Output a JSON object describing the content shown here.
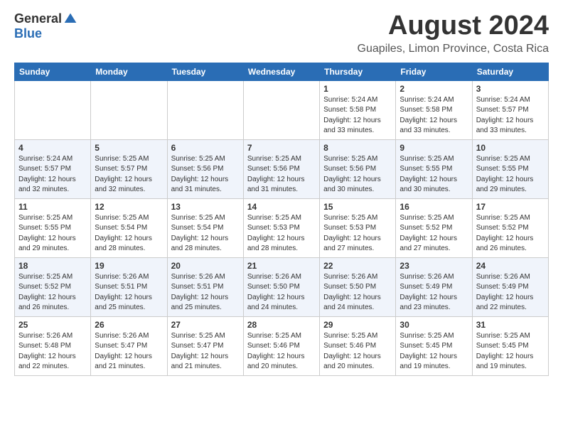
{
  "header": {
    "logo_general": "General",
    "logo_blue": "Blue",
    "month_title": "August 2024",
    "subtitle": "Guapiles, Limon Province, Costa Rica"
  },
  "calendar": {
    "days_of_week": [
      "Sunday",
      "Monday",
      "Tuesday",
      "Wednesday",
      "Thursday",
      "Friday",
      "Saturday"
    ],
    "weeks": [
      [
        {
          "day": "",
          "info": ""
        },
        {
          "day": "",
          "info": ""
        },
        {
          "day": "",
          "info": ""
        },
        {
          "day": "",
          "info": ""
        },
        {
          "day": "1",
          "info": "Sunrise: 5:24 AM\nSunset: 5:58 PM\nDaylight: 12 hours\nand 33 minutes."
        },
        {
          "day": "2",
          "info": "Sunrise: 5:24 AM\nSunset: 5:58 PM\nDaylight: 12 hours\nand 33 minutes."
        },
        {
          "day": "3",
          "info": "Sunrise: 5:24 AM\nSunset: 5:57 PM\nDaylight: 12 hours\nand 33 minutes."
        }
      ],
      [
        {
          "day": "4",
          "info": "Sunrise: 5:24 AM\nSunset: 5:57 PM\nDaylight: 12 hours\nand 32 minutes."
        },
        {
          "day": "5",
          "info": "Sunrise: 5:25 AM\nSunset: 5:57 PM\nDaylight: 12 hours\nand 32 minutes."
        },
        {
          "day": "6",
          "info": "Sunrise: 5:25 AM\nSunset: 5:56 PM\nDaylight: 12 hours\nand 31 minutes."
        },
        {
          "day": "7",
          "info": "Sunrise: 5:25 AM\nSunset: 5:56 PM\nDaylight: 12 hours\nand 31 minutes."
        },
        {
          "day": "8",
          "info": "Sunrise: 5:25 AM\nSunset: 5:56 PM\nDaylight: 12 hours\nand 30 minutes."
        },
        {
          "day": "9",
          "info": "Sunrise: 5:25 AM\nSunset: 5:55 PM\nDaylight: 12 hours\nand 30 minutes."
        },
        {
          "day": "10",
          "info": "Sunrise: 5:25 AM\nSunset: 5:55 PM\nDaylight: 12 hours\nand 29 minutes."
        }
      ],
      [
        {
          "day": "11",
          "info": "Sunrise: 5:25 AM\nSunset: 5:55 PM\nDaylight: 12 hours\nand 29 minutes."
        },
        {
          "day": "12",
          "info": "Sunrise: 5:25 AM\nSunset: 5:54 PM\nDaylight: 12 hours\nand 28 minutes."
        },
        {
          "day": "13",
          "info": "Sunrise: 5:25 AM\nSunset: 5:54 PM\nDaylight: 12 hours\nand 28 minutes."
        },
        {
          "day": "14",
          "info": "Sunrise: 5:25 AM\nSunset: 5:53 PM\nDaylight: 12 hours\nand 28 minutes."
        },
        {
          "day": "15",
          "info": "Sunrise: 5:25 AM\nSunset: 5:53 PM\nDaylight: 12 hours\nand 27 minutes."
        },
        {
          "day": "16",
          "info": "Sunrise: 5:25 AM\nSunset: 5:52 PM\nDaylight: 12 hours\nand 27 minutes."
        },
        {
          "day": "17",
          "info": "Sunrise: 5:25 AM\nSunset: 5:52 PM\nDaylight: 12 hours\nand 26 minutes."
        }
      ],
      [
        {
          "day": "18",
          "info": "Sunrise: 5:25 AM\nSunset: 5:52 PM\nDaylight: 12 hours\nand 26 minutes."
        },
        {
          "day": "19",
          "info": "Sunrise: 5:26 AM\nSunset: 5:51 PM\nDaylight: 12 hours\nand 25 minutes."
        },
        {
          "day": "20",
          "info": "Sunrise: 5:26 AM\nSunset: 5:51 PM\nDaylight: 12 hours\nand 25 minutes."
        },
        {
          "day": "21",
          "info": "Sunrise: 5:26 AM\nSunset: 5:50 PM\nDaylight: 12 hours\nand 24 minutes."
        },
        {
          "day": "22",
          "info": "Sunrise: 5:26 AM\nSunset: 5:50 PM\nDaylight: 12 hours\nand 24 minutes."
        },
        {
          "day": "23",
          "info": "Sunrise: 5:26 AM\nSunset: 5:49 PM\nDaylight: 12 hours\nand 23 minutes."
        },
        {
          "day": "24",
          "info": "Sunrise: 5:26 AM\nSunset: 5:49 PM\nDaylight: 12 hours\nand 22 minutes."
        }
      ],
      [
        {
          "day": "25",
          "info": "Sunrise: 5:26 AM\nSunset: 5:48 PM\nDaylight: 12 hours\nand 22 minutes."
        },
        {
          "day": "26",
          "info": "Sunrise: 5:26 AM\nSunset: 5:47 PM\nDaylight: 12 hours\nand 21 minutes."
        },
        {
          "day": "27",
          "info": "Sunrise: 5:25 AM\nSunset: 5:47 PM\nDaylight: 12 hours\nand 21 minutes."
        },
        {
          "day": "28",
          "info": "Sunrise: 5:25 AM\nSunset: 5:46 PM\nDaylight: 12 hours\nand 20 minutes."
        },
        {
          "day": "29",
          "info": "Sunrise: 5:25 AM\nSunset: 5:46 PM\nDaylight: 12 hours\nand 20 minutes."
        },
        {
          "day": "30",
          "info": "Sunrise: 5:25 AM\nSunset: 5:45 PM\nDaylight: 12 hours\nand 19 minutes."
        },
        {
          "day": "31",
          "info": "Sunrise: 5:25 AM\nSunset: 5:45 PM\nDaylight: 12 hours\nand 19 minutes."
        }
      ]
    ]
  }
}
